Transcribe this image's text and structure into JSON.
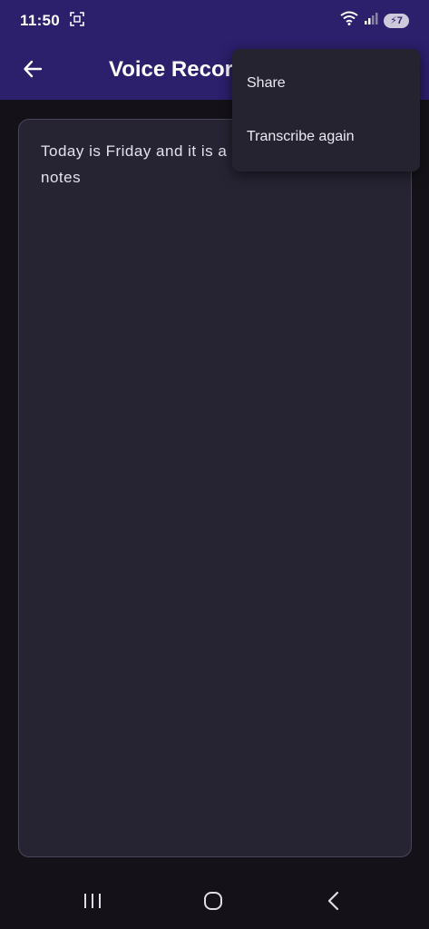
{
  "status_bar": {
    "time": "11:50",
    "battery_level": "7"
  },
  "app_bar": {
    "title": "Voice Recorder",
    "back_icon": "arrow-left-icon"
  },
  "note": {
    "text": "Today is Friday and it is a good day to edit my notes"
  },
  "popup_menu": {
    "items": [
      {
        "label": "Share"
      },
      {
        "label": "Transcribe again"
      }
    ]
  },
  "nav_bar": {
    "recents_icon": "recents-icon",
    "home_icon": "home-icon",
    "back_icon": "back-chevron-icon"
  },
  "colors": {
    "app_bar": "#2c1f6b",
    "background": "#141218",
    "card": "#262433",
    "menu": "#25232f"
  }
}
